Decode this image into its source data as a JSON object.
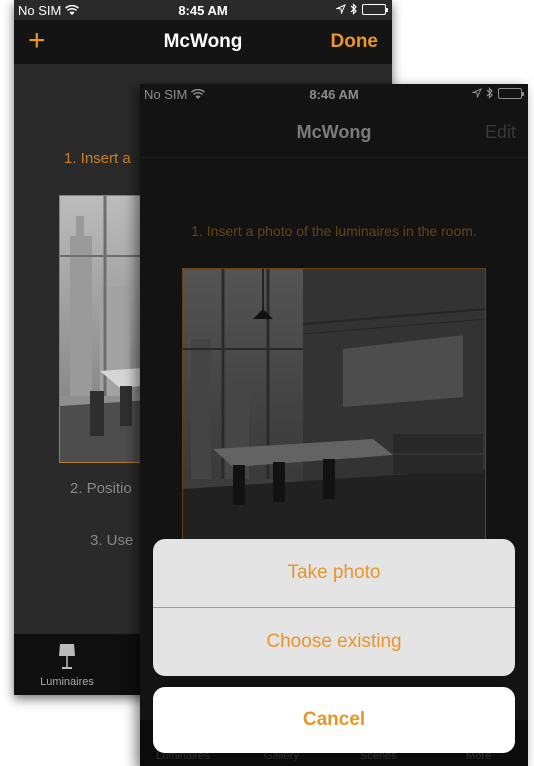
{
  "back_screen": {
    "status": {
      "carrier": "No SIM",
      "time": "8:45 AM"
    },
    "nav": {
      "add_label": "+",
      "title": "McWong",
      "done_label": "Done"
    },
    "steps": {
      "step1": "1. Insert a",
      "step2": "2. Positio",
      "step3": "3. Use"
    },
    "tabbar": {
      "luminaires": "Luminaires"
    }
  },
  "front_screen": {
    "status": {
      "carrier": "No SIM",
      "time": "8:46 AM"
    },
    "nav": {
      "title": "McWong",
      "edit_label": "Edit"
    },
    "step1": "1. Insert a photo of the luminaires in the room.",
    "action_sheet": {
      "take_photo": "Take photo",
      "choose_existing": "Choose existing",
      "cancel": "Cancel"
    },
    "tabbar": {
      "luminaires": "Luminaires",
      "gallery": "Gallery",
      "scenes": "Scenes",
      "more": "More"
    }
  },
  "colors": {
    "accent": "#e8952a",
    "battery": "#4cd964"
  }
}
